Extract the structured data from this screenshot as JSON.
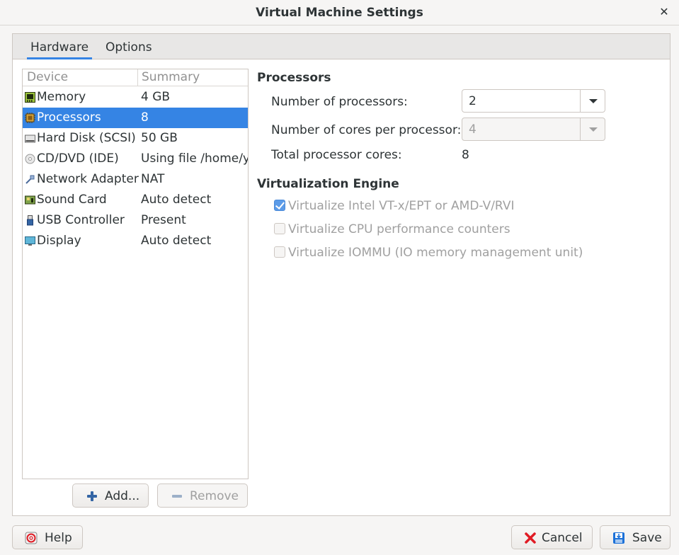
{
  "window": {
    "title": "Virtual Machine Settings",
    "close_glyph": "✕"
  },
  "tabs": [
    {
      "label": "Hardware",
      "active": true
    },
    {
      "label": "Options",
      "active": false
    }
  ],
  "device_list": {
    "columns": [
      "Device",
      "Summary"
    ],
    "rows": [
      {
        "icon": "memory-icon",
        "name": "Memory",
        "summary": "4 GB"
      },
      {
        "icon": "processor-icon",
        "name": "Processors",
        "summary": "8",
        "selected": true
      },
      {
        "icon": "hard-disk-icon",
        "name": "Hard Disk (SCSI)",
        "summary": "50 GB"
      },
      {
        "icon": "cd-dvd-icon",
        "name": "CD/DVD (IDE)",
        "summary": "Using file /home/yi"
      },
      {
        "icon": "network-adapter-icon",
        "name": "Network Adapter",
        "summary": "NAT"
      },
      {
        "icon": "sound-card-icon",
        "name": "Sound Card",
        "summary": "Auto detect"
      },
      {
        "icon": "usb-controller-icon",
        "name": "USB Controller",
        "summary": "Present"
      },
      {
        "icon": "display-icon",
        "name": "Display",
        "summary": "Auto detect"
      }
    ],
    "add_label": "Add...",
    "remove_label": "Remove"
  },
  "processors": {
    "title": "Processors",
    "num_processors_label": "Number of processors:",
    "num_processors_value": "2",
    "cores_label": "Number of cores per processor:",
    "cores_value": "4",
    "total_label": "Total processor cores:",
    "total_value": "8"
  },
  "virtualization": {
    "title": "Virtualization Engine",
    "options": [
      {
        "label": "Virtualize Intel VT-x/EPT or AMD-V/RVI",
        "checked": true
      },
      {
        "label": "Virtualize CPU performance counters",
        "checked": false
      },
      {
        "label": "Virtualize IOMMU (IO memory management unit)",
        "checked": false
      }
    ]
  },
  "footer": {
    "help_label": "Help",
    "cancel_label": "Cancel",
    "save_label": "Save"
  },
  "colors": {
    "accent": "#3584e4",
    "cancel_red": "#e01b24",
    "save_blue": "#1c71d8"
  }
}
